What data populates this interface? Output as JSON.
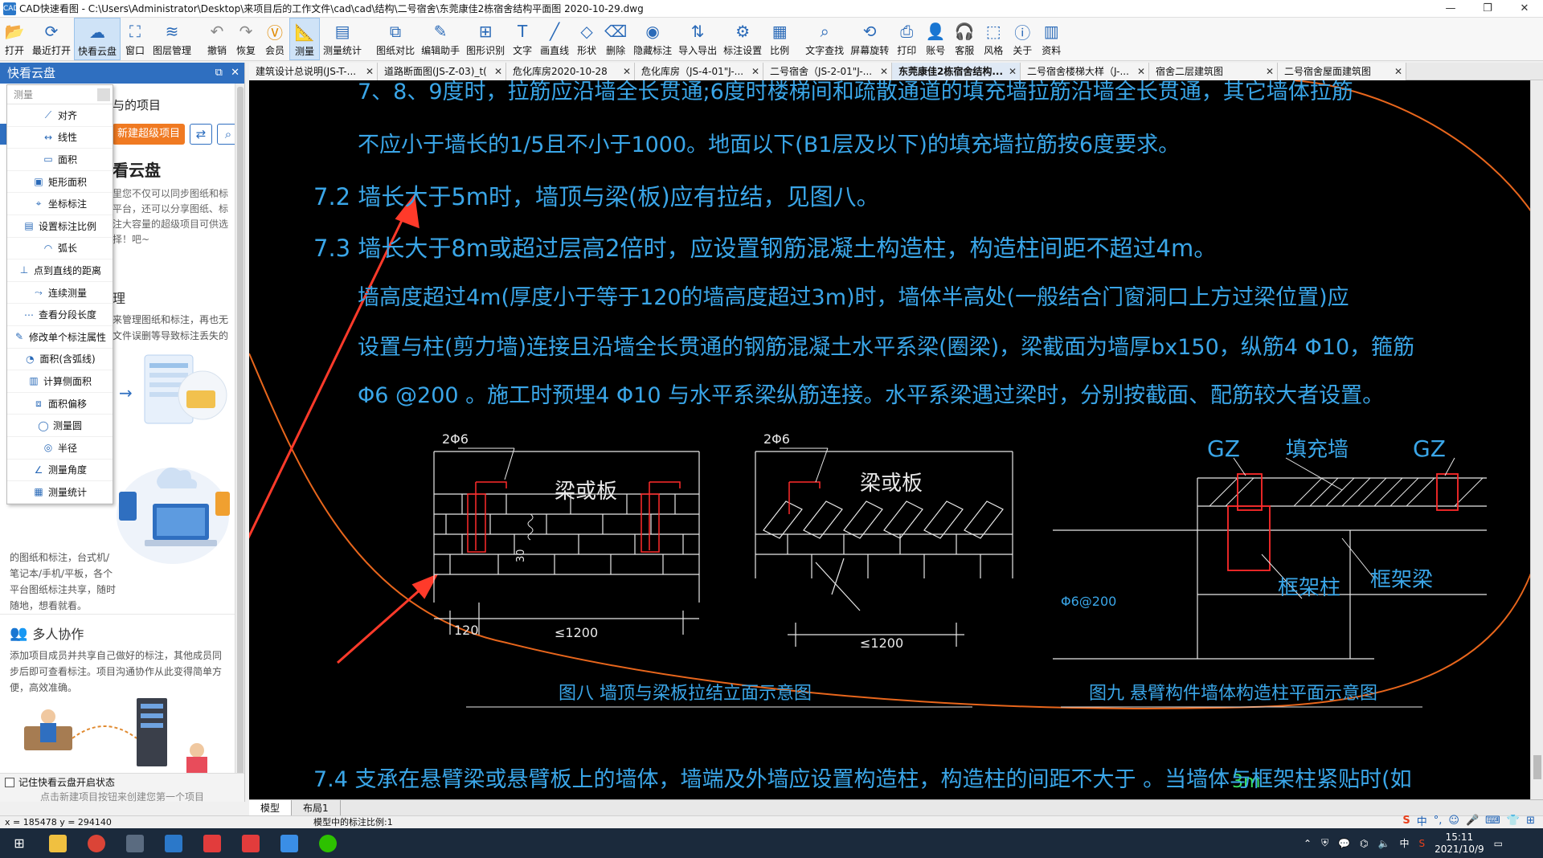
{
  "window": {
    "app_icon": "CAD",
    "title": "CAD快速看图 - C:\\Users\\Administrator\\Desktop\\来项目后的工作文件\\cad\\cad\\结构\\二号宿舍\\东莞康佳2栋宿舍结构平面图 2020-10-29.dwg",
    "min": "—",
    "max": "❐",
    "close": "✕"
  },
  "toolbar": [
    {
      "name": "open",
      "label": "打开",
      "icon": "folder-icon",
      "glyph": "📂"
    },
    {
      "name": "recent",
      "label": "最近打开",
      "icon": "recent-icon",
      "glyph": "⟳"
    },
    {
      "name": "cloud",
      "label": "快看云盘",
      "icon": "cloud-icon",
      "glyph": "☁",
      "active": true
    },
    {
      "name": "window",
      "label": "窗口",
      "icon": "window-icon",
      "glyph": "⛶"
    },
    {
      "name": "layers",
      "label": "图层管理",
      "icon": "layers-icon",
      "glyph": "≋"
    },
    {
      "name": "undo",
      "label": "撤销",
      "icon": "undo-icon",
      "glyph": "↶"
    },
    {
      "name": "redo",
      "label": "恢复",
      "icon": "redo-icon",
      "glyph": "↷"
    },
    {
      "name": "vip",
      "label": "会员",
      "icon": "vip-icon",
      "glyph": "Ⓥ"
    },
    {
      "name": "measure",
      "label": "测量",
      "icon": "measure-icon",
      "glyph": "📐",
      "active": true
    },
    {
      "name": "measure-stats",
      "label": "测量统计",
      "icon": "stats-icon",
      "glyph": "▤"
    },
    {
      "name": "compare",
      "label": "图纸对比",
      "icon": "compare-icon",
      "glyph": "⧉"
    },
    {
      "name": "edit",
      "label": "编辑助手",
      "icon": "edit-icon",
      "glyph": "✎"
    },
    {
      "name": "recognize",
      "label": "图形识别",
      "icon": "recognize-icon",
      "glyph": "⊞"
    },
    {
      "name": "text",
      "label": "文字",
      "icon": "text-icon",
      "glyph": "T"
    },
    {
      "name": "line",
      "label": "画直线",
      "icon": "line-icon",
      "glyph": "╱"
    },
    {
      "name": "shape",
      "label": "形状",
      "icon": "shape-icon",
      "glyph": "◇"
    },
    {
      "name": "erase",
      "label": "删除",
      "icon": "erase-icon",
      "glyph": "⌫"
    },
    {
      "name": "hide",
      "label": "隐藏标注",
      "icon": "eye-icon",
      "glyph": "◉"
    },
    {
      "name": "import-export",
      "label": "导入导出",
      "icon": "import-export-icon",
      "glyph": "⇅"
    },
    {
      "name": "annot-settings",
      "label": "标注设置",
      "icon": "settings-icon",
      "glyph": "⚙"
    },
    {
      "name": "scale",
      "label": "比例",
      "icon": "scale-icon",
      "glyph": "▦"
    },
    {
      "name": "text-search",
      "label": "文字查找",
      "icon": "search-icon",
      "glyph": "⌕"
    },
    {
      "name": "rotate",
      "label": "屏幕旋转",
      "icon": "rotate-icon",
      "glyph": "⟲"
    },
    {
      "name": "print",
      "label": "打印",
      "icon": "print-icon",
      "glyph": "⎙"
    },
    {
      "name": "account",
      "label": "账号",
      "icon": "account-icon",
      "glyph": "👤"
    },
    {
      "name": "service",
      "label": "客服",
      "icon": "headset-icon",
      "glyph": "🎧"
    },
    {
      "name": "style",
      "label": "风格",
      "icon": "style-icon",
      "glyph": "⬚"
    },
    {
      "name": "about",
      "label": "关于",
      "icon": "info-icon",
      "glyph": "ⓘ"
    },
    {
      "name": "resources",
      "label": "资料",
      "icon": "resources-icon",
      "glyph": "▥"
    }
  ],
  "tabs": [
    {
      "label": "建筑设计总说明(JS-T-...",
      "active": false
    },
    {
      "label": "道路断面图(JS-Z-03)_t(",
      "active": false
    },
    {
      "label": "危化库房2020-10-28",
      "active": false
    },
    {
      "label": "危化库房（JS-4-01\"J-...",
      "active": false
    },
    {
      "label": "二号宿舍（JS-2-01\"J-...",
      "active": false
    },
    {
      "label": "东莞康佳2栋宿舍结构...",
      "active": true
    },
    {
      "label": "二号宿舍楼梯大样（J-...",
      "active": false
    },
    {
      "label": "宿舍二层建筑图",
      "active": false
    },
    {
      "label": "二号宿舍屋面建筑图",
      "active": false
    }
  ],
  "left_panel": {
    "title": "快看云盘",
    "my_projects": "与的项目",
    "new_super_project": "新建超级项目",
    "promo_title": "看云盘",
    "promo_text": "里您不仅可以同步图纸和标平台，还可以分享图纸、标注大容量的超级项目可供选择！吧~",
    "manage_title": "理",
    "manage_text": "来管理图纸和标注，再也无文件误删等导致标注丢失的",
    "sync_text": "的图纸和标注，台式机/笔记本/手机/平板，各个平台图纸标注共享，随时随地，想看就看。",
    "collab_title": "多人协作",
    "collab_text": "添加项目成员并共享自己做好的标注，其他成员同步后即可查看标注。项目沟通协作从此变得简单方便，高效准确。",
    "remember_label": "记住快看云盘开启状态",
    "hint": "点击新建项目按钮来创建您第一个项目"
  },
  "measure_menu": {
    "header": "测量",
    "items": [
      {
        "label": "对齐",
        "icon": "align-icon",
        "glyph": "⟋"
      },
      {
        "label": "线性",
        "icon": "linear-icon",
        "glyph": "↔"
      },
      {
        "label": "面积",
        "icon": "area-icon",
        "glyph": "▭"
      },
      {
        "label": "矩形面积",
        "icon": "rect-area-icon",
        "glyph": "▣"
      },
      {
        "label": "坐标标注",
        "icon": "coordinate-icon",
        "glyph": "⌖"
      },
      {
        "label": "设置标注比例",
        "icon": "scale-icon",
        "glyph": "▤"
      },
      {
        "label": "弧长",
        "icon": "arc-icon",
        "glyph": "◠"
      },
      {
        "label": "点到直线的距离",
        "icon": "point-line-icon",
        "glyph": "⊥"
      },
      {
        "label": "连续测量",
        "icon": "continuous-icon",
        "glyph": "⤳"
      },
      {
        "label": "查看分段长度",
        "icon": "segment-icon",
        "glyph": "⋯"
      },
      {
        "label": "修改单个标注属性",
        "icon": "modify-icon",
        "glyph": "✎"
      },
      {
        "label": "面积(含弧线)",
        "icon": "arc-area-icon",
        "glyph": "◔"
      },
      {
        "label": "计算侧面积",
        "icon": "side-area-icon",
        "glyph": "▥"
      },
      {
        "label": "面积偏移",
        "icon": "offset-icon",
        "glyph": "⧈"
      },
      {
        "label": "测量圆",
        "icon": "circle-icon",
        "glyph": "◯"
      },
      {
        "label": "半径",
        "icon": "radius-icon",
        "glyph": "◎"
      },
      {
        "label": "测量角度",
        "icon": "angle-icon",
        "glyph": "∠"
      },
      {
        "label": "测量统计",
        "icon": "stats-icon",
        "glyph": "▦"
      }
    ]
  },
  "drawing": {
    "lines": [
      "7、8、9度时，拉筋应沿墙全长贯通;6度时楼梯间和疏散通道的填充墙拉筋沿墙全长贯通，其它墙体拉筋",
      "不应小于墙长的1/5且不小于1000。地面以下(B1层及以下)的填充墙拉筋按6度要求。",
      "7.2  墙长大于5m时，墙顶与梁(板)应有拉结，见图八。",
      "7.3  墙长大于8m或超过层高2倍时，应设置钢筋混凝土构造柱，构造柱间距不超过4m。",
      "墙高度超过4m(厚度小于等于120的墙高度超过3m)时，墙体半高处(一般结合门窗洞口上方过梁位置)应",
      "设置与柱(剪力墙)连接且沿墙全长贯通的钢筋混凝土水平系梁(圈梁)，梁截面为墙厚bx150，纵筋4 Φ10，箍筋",
      "Φ6 @200   。施工时预埋4 Φ10 与水平系梁纵筋连接。水平系梁遇过梁时，分别按截面、配筋较大者设置。",
      "7.4  支承在悬臂梁或悬臂板上的墙体，墙端及外墙应设置构造柱，构造柱的间距不大于      。当墙体与框架柱紧贴时(如"
    ],
    "fig8_left_rebar": "2Φ6",
    "fig8_right_rebar": "2Φ6",
    "beam_label": "梁或板",
    "dim_120": "120",
    "dim_1200a": "≤1200",
    "dim_1200b": "≤1200",
    "dim_30": "30",
    "gz_left": "GZ",
    "gz_right": "GZ",
    "infill": "填充墙",
    "frame_col": "框架柱",
    "frame_beam": "框架梁",
    "stirrup": "Φ6@200",
    "fig8_title": "图八  墙顶与梁板拉结立面示意图",
    "fig9_title": "图九  悬臂构件墙体构造柱平面示意图",
    "green_mark": "3m",
    "colors": {
      "cad_text": "#3aa6e8",
      "cad_white": "#e8e8e8",
      "cad_red": "#ff2a2a",
      "annot": "#ff4a2a",
      "orange_curve": "#e8661c"
    }
  },
  "layout_tabs": [
    {
      "label": "模型",
      "active": true
    },
    {
      "label": "布局1",
      "active": false
    }
  ],
  "status": {
    "coords": "x = 185478  y = 294140",
    "scale_text": "模型中的标注比例:1"
  },
  "tray": {
    "ime_lang": "中",
    "time": "15:11",
    "date": "2021/10/9"
  }
}
